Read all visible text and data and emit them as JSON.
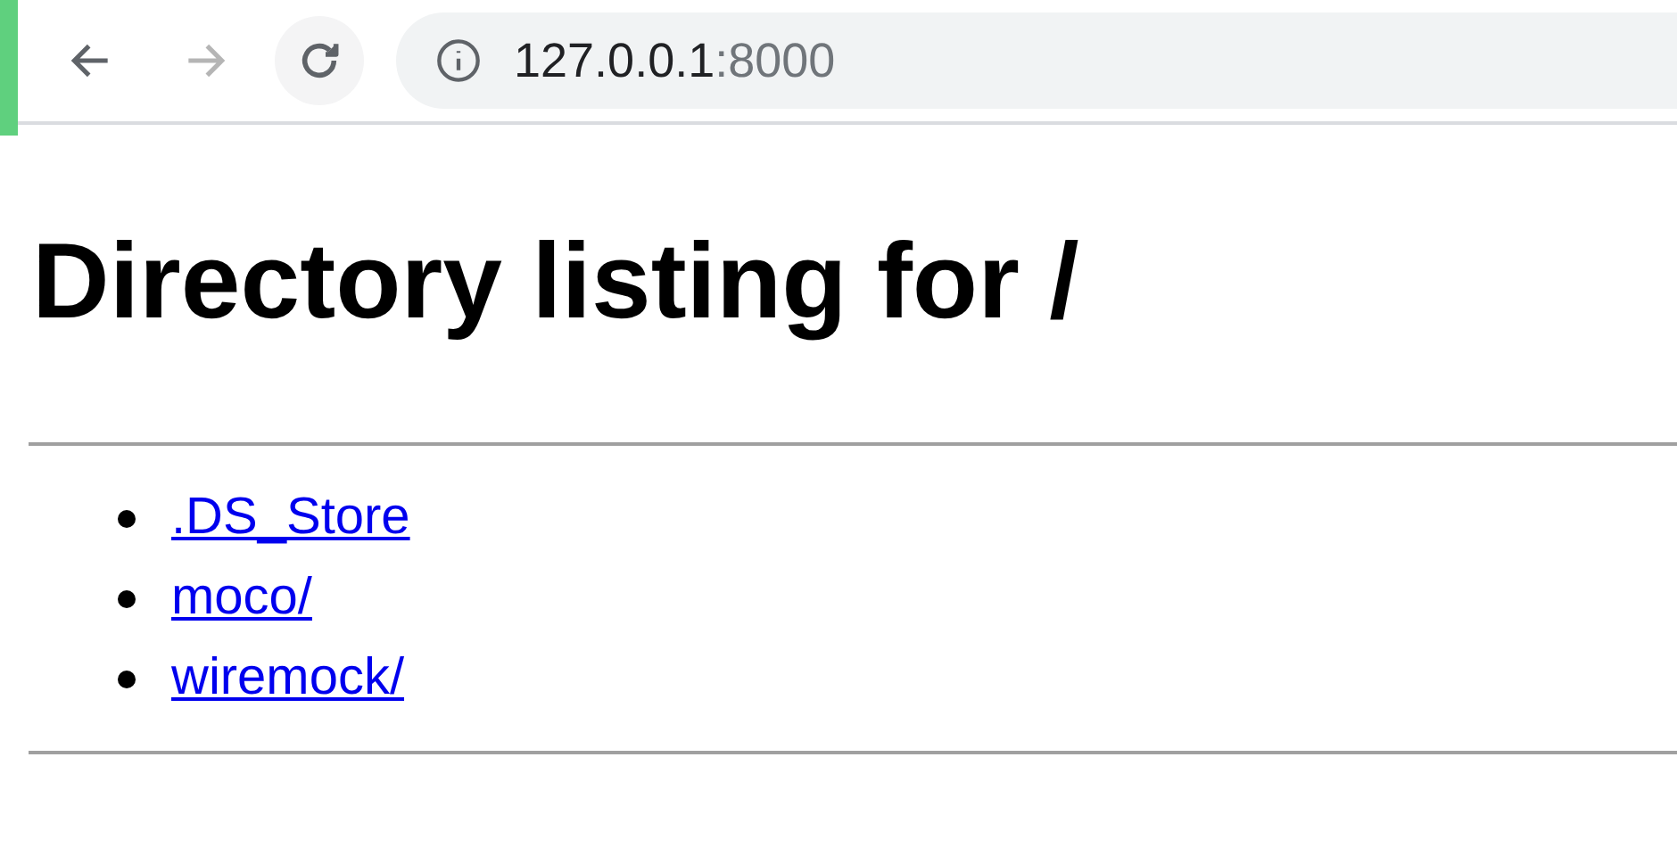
{
  "toolbar": {
    "buttons": [
      {
        "kind": "back",
        "disabled": false
      },
      {
        "kind": "forward",
        "disabled": true
      },
      {
        "kind": "reload",
        "disabled": false
      }
    ],
    "address": {
      "host": "127.0.0.1",
      "port": ":8000"
    }
  },
  "page": {
    "heading": "Directory listing for /",
    "items": [
      {
        "label": ".DS_Store"
      },
      {
        "label": "moco/"
      },
      {
        "label": "wiremock/"
      }
    ]
  }
}
